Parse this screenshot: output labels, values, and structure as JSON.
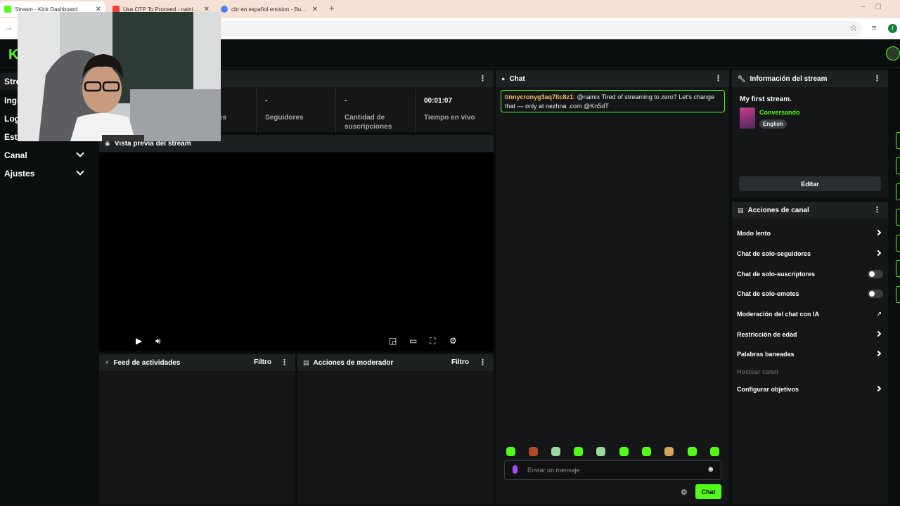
{
  "browser": {
    "tabs": [
      {
        "title": "Stream - Kick Dashboard",
        "icon": "kick-icon",
        "active": true
      },
      {
        "title": "Use OTP To Proceed - nainix98",
        "icon": "gmail-icon",
        "active": false
      },
      {
        "title": "cbr en español emision - Busca",
        "icon": "google-icon",
        "active": false
      }
    ],
    "new_tab": "+",
    "profile_initial": "I"
  },
  "app": {
    "logo": "K"
  },
  "sidebar": {
    "items": [
      {
        "label": "Stre",
        "active": true
      },
      {
        "label": "Ingr"
      },
      {
        "label": "Logr"
      },
      {
        "label": "Estu"
      },
      {
        "label": "Canal",
        "expandable": true
      },
      {
        "label": "Ajustes",
        "expandable": true
      }
    ]
  },
  "stats": [
    {
      "value": "",
      "label": "es"
    },
    {
      "value": "-",
      "label": "Seguidores"
    },
    {
      "value": "-",
      "label": "Cantidad de suscripciones"
    },
    {
      "value": "00:01:07",
      "label": "Tiempo en vivo"
    }
  ],
  "preview": {
    "title": "Vista previa del stream"
  },
  "activity": {
    "title": "Feed de actividades",
    "filter": "Filtro"
  },
  "modactions": {
    "title": "Acciones de moderador",
    "filter": "Filtro"
  },
  "chat": {
    "title": "Chat",
    "message": {
      "user": "tinnycronyg3aq7ltc8z1:",
      "text": " @nainix Tired of streaming to zero? Let's change that — only at nezhna .com @Kn5dT"
    },
    "placeholder": "Enviar un mensaje",
    "send": "Chat"
  },
  "info": {
    "title": "Información del stream",
    "stream_title": "My first stream.",
    "category": "Conversando",
    "language": "English",
    "edit": "Editar"
  },
  "actions": {
    "title": "Acciones de canal",
    "items": [
      {
        "label": "Modo lento",
        "control": "chevron"
      },
      {
        "label": "Chat de solo-seguidores",
        "control": "chevron"
      },
      {
        "label": "Chat de solo-suscriptores",
        "control": "toggle"
      },
      {
        "label": "Chat de solo-emotes",
        "control": "toggle"
      },
      {
        "label": "Moderación del chat con IA",
        "control": "external"
      },
      {
        "label": "Restricción de edad",
        "control": "chevron"
      },
      {
        "label": "Palabras baneadas",
        "control": "chevron"
      },
      {
        "label": "Hostear canal",
        "control": "disabled"
      },
      {
        "label": "Configurar objetivos",
        "control": "chevron"
      }
    ]
  },
  "colors": {
    "accent": "#53fc18",
    "panel": "#141617",
    "header": "#1e2122"
  }
}
